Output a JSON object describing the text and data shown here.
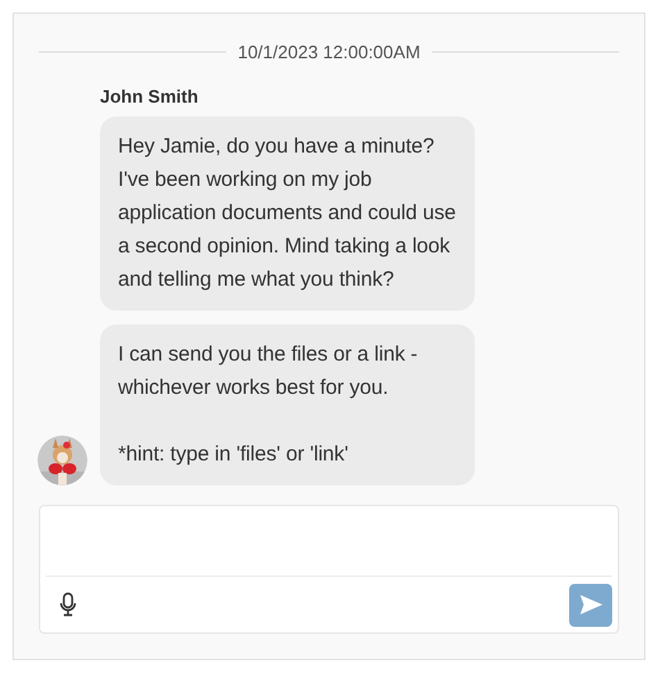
{
  "timestamp": "10/1/2023 12:00:00AM",
  "sender": {
    "name": "John Smith"
  },
  "messages": [
    {
      "paragraphs": [
        "Hey Jamie, do you have a minute? I've been working on my job application documents and could use a second opinion. Mind taking a look and telling me what you think?"
      ]
    },
    {
      "paragraphs": [
        "I can send you the files or a link - whichever works best for you.",
        "*hint: type in 'files' or 'link'"
      ]
    }
  ],
  "composer": {
    "send_disabled": true
  }
}
